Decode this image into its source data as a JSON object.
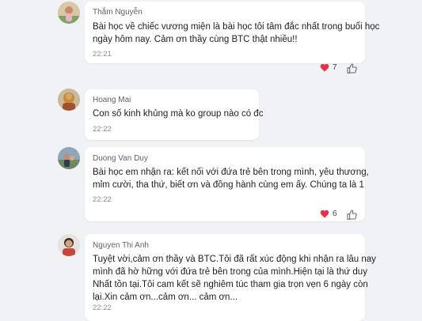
{
  "comments": [
    {
      "author": "Thắm Nguyễn",
      "lines": [
        "Bài học về chiếc vương miện là bài học tôi tâm đắc nhất trong buổi học",
        "ngày hôm nay. Cảm ơn thầy cùng BTC thật nhiều!!"
      ],
      "time": "22:21",
      "reactions": {
        "icon": "heart-icon",
        "count": "7"
      }
    },
    {
      "author": "Hoang Mai",
      "lines": [
        "Con số kinh khủng mà ko group nào có đc"
      ],
      "time": "22:22"
    },
    {
      "author": "Duong Van Duy",
      "lines": [
        "Bài học em nhận ra: kết nối với đứa trẻ bên trong mình, yêu thương,",
        "mỉm cười, tha thứ, biết ơn và đồng hành cùng em ấy. Chúng ta là 1"
      ],
      "time": "22:22",
      "reactions": {
        "icon": "heart-icon",
        "count": "6"
      }
    },
    {
      "author": "Nguyen Thi Anh",
      "lines": [
        "Tuyệt vời,cảm ơn thầy và BTC.Tôi đã rất xúc động khi nhận ra lâu nay",
        "mình đã hờ hững với đứa trẻ bên trong của mình.Hiện tại là thứ duy",
        "Nhất tồn tại.Tôi cam kết sẽ nghiêm túc tham gia trọn vẹn 6 ngày còn",
        "lại.Xin cảm ơn...cảm ơn... cảm ơn..."
      ],
      "time": "22:22"
    }
  ],
  "colors": {
    "background": "#f0f2f5",
    "bubble": "#ffffff",
    "heart": "#e8324a",
    "like": "#65676b"
  }
}
